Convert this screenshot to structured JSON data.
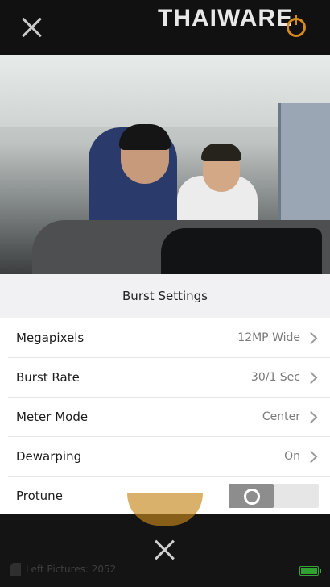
{
  "watermark": "THAIWARE",
  "sheet": {
    "title": "Burst Settings",
    "rows": [
      {
        "label": "Megapixels",
        "value": "12MP Wide"
      },
      {
        "label": "Burst Rate",
        "value": "30/1 Sec"
      },
      {
        "label": "Meter Mode",
        "value": "Center"
      },
      {
        "label": "Dewarping",
        "value": "On"
      },
      {
        "label": "Protune",
        "value": ""
      }
    ]
  },
  "status": {
    "pictures_left": "Left Pictures: 2052"
  },
  "icons": {
    "close": "close-icon",
    "power": "power-icon",
    "chevron": "chevron-right-icon",
    "card": "sd-card-icon",
    "battery": "battery-icon"
  },
  "colors": {
    "accent": "#d58a1a",
    "battery": "#2fa12f"
  }
}
